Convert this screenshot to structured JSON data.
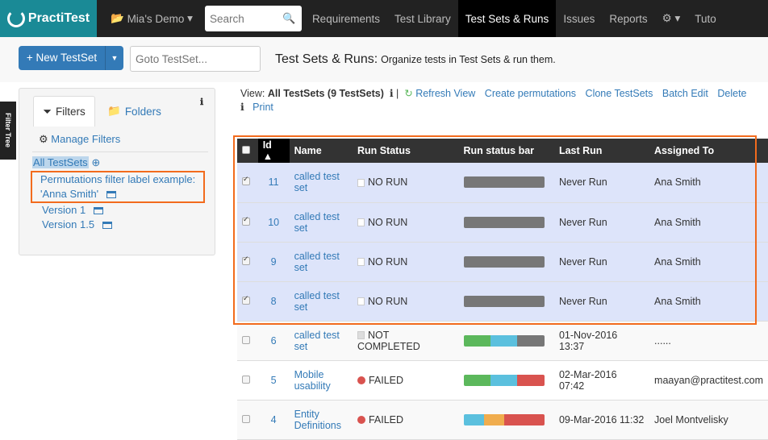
{
  "nav": {
    "logo": "PractiTest",
    "project": "Mia's Demo",
    "search_placeholder": "Search",
    "items": [
      "Requirements",
      "Test Library",
      "Test Sets & Runs",
      "Issues",
      "Reports"
    ],
    "active": "Test Sets & Runs",
    "extra": "Tuto"
  },
  "toolbar": {
    "new_label": "+ New TestSet",
    "goto_placeholder": "Goto TestSet...",
    "title": "Test Sets & Runs:",
    "subtitle": "Organize tests in Test Sets & run them."
  },
  "filters": {
    "side_tab": "Filter Tree",
    "tab_filters": "Filters",
    "tab_folders": "Folders",
    "manage": "Manage Filters",
    "all": "All TestSets",
    "perm_label": "Permutations filter label example:",
    "perm_value": "'Anna Smith'",
    "versions": [
      "Version 1",
      "Version 1.5"
    ]
  },
  "view": {
    "prefix": "View:",
    "name": "All TestSets (9 TestSets)",
    "actions": [
      "Refresh View",
      "Create permutations",
      "Clone TestSets",
      "Batch Edit",
      "Delete"
    ],
    "print": "Print"
  },
  "table": {
    "headers": [
      "Id",
      "Name",
      "Run Status",
      "Run status bar",
      "Last Run",
      "Assigned To"
    ],
    "colors": {
      "green": "#5cb85c",
      "blue": "#5bc0de",
      "gray": "#777777",
      "red": "#d9534f",
      "orange": "#f0ad4e"
    },
    "rows": [
      {
        "id": "11",
        "name": "called test set",
        "status": "NO RUN",
        "last": "Never Run",
        "assigned": "Ana Smith",
        "checked": true,
        "bar": [
          [
            "gray",
            100
          ]
        ]
      },
      {
        "id": "10",
        "name": "called test set",
        "status": "NO RUN",
        "last": "Never Run",
        "assigned": "Ana Smith",
        "checked": true,
        "bar": [
          [
            "gray",
            100
          ]
        ]
      },
      {
        "id": "9",
        "name": "called test set",
        "status": "NO RUN",
        "last": "Never Run",
        "assigned": "Ana Smith",
        "checked": true,
        "bar": [
          [
            "gray",
            100
          ]
        ]
      },
      {
        "id": "8",
        "name": "called test set",
        "status": "NO RUN",
        "last": "Never Run",
        "assigned": "Ana Smith",
        "checked": true,
        "bar": [
          [
            "gray",
            100
          ]
        ]
      },
      {
        "id": "6",
        "name": "called test set",
        "status": "NOT COMPLETED",
        "last": "01-Nov-2016 13:37",
        "assigned": "......",
        "checked": false,
        "bar": [
          [
            "green",
            33
          ],
          [
            "blue",
            33
          ],
          [
            "gray",
            34
          ]
        ]
      },
      {
        "id": "5",
        "name": "Mobile usability",
        "status": "FAILED",
        "last": "02-Mar-2016 07:42",
        "assigned": "maayan@practitest.com",
        "checked": false,
        "bar": [
          [
            "green",
            33
          ],
          [
            "blue",
            33
          ],
          [
            "red",
            34
          ]
        ]
      },
      {
        "id": "4",
        "name": "Entity Definitions",
        "status": "FAILED",
        "last": "09-Mar-2016 11:32",
        "assigned": "Joel Montvelisky",
        "checked": false,
        "bar": [
          [
            "blue",
            25
          ],
          [
            "orange",
            25
          ],
          [
            "red",
            50
          ]
        ]
      }
    ]
  }
}
